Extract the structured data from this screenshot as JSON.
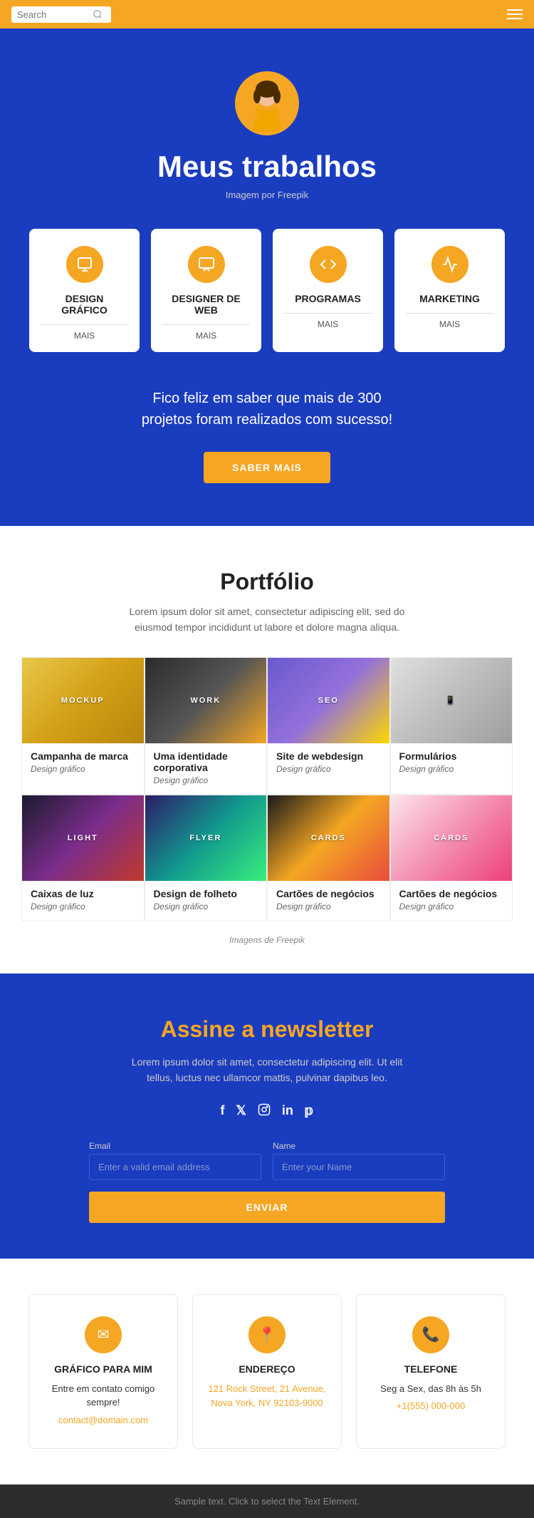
{
  "header": {
    "search_placeholder": "Search",
    "menu_icon": "hamburger-icon"
  },
  "hero": {
    "title": "Meus trabalhos",
    "image_credit": "Imagem por Freepik",
    "promo_text": "Fico feliz em saber que mais de 300 projetos foram realizados com sucesso!",
    "cta_label": "SABER MAIS"
  },
  "services": [
    {
      "title": "DESIGN\nGRÁFICO",
      "mais": "MAIS",
      "icon": "🖥"
    },
    {
      "title": "DESIGNER DE WEB",
      "mais": "MAIS",
      "icon": "🖱"
    },
    {
      "title": "PROGRAMAS",
      "mais": "MAIS",
      "icon": "💻"
    },
    {
      "title": "MARKETING",
      "mais": "MAIS",
      "icon": "📊"
    }
  ],
  "portfolio": {
    "title": "Portfólio",
    "description": "Lorem ipsum dolor sit amet, consectetur adipiscing elit, sed do eiusmod tempor incididunt ut labore et dolore magna aliqua.",
    "freepik_note": "Imagens de Freepik",
    "items": [
      {
        "title": "Campanha de marca",
        "category": "Design gráfico",
        "img_class": "img-mockup",
        "label": "MOCKUP"
      },
      {
        "title": "Uma identidade corporativa",
        "category": "Design gráfico",
        "img_class": "img-work",
        "label": "WORK"
      },
      {
        "title": "Site de webdesign",
        "category": "Design gráfico",
        "img_class": "img-seo",
        "label": "SEO"
      },
      {
        "title": "Formulários",
        "category": "Design gráfico",
        "img_class": "img-phone",
        "label": "PHONE"
      },
      {
        "title": "Caixas de luz",
        "category": "Design gráfico",
        "img_class": "img-light",
        "label": "LIGHT"
      },
      {
        "title": "Design de folheto",
        "category": "Design gráfico",
        "img_class": "img-flyer",
        "label": "FLYER"
      },
      {
        "title": "Cartões de negócios",
        "category": "Design gráfico",
        "img_class": "img-business1",
        "label": "CARDS"
      },
      {
        "title": "Cartões de negócios",
        "category": "Design gráfico",
        "img_class": "img-business2",
        "label": "CARDS"
      }
    ]
  },
  "newsletter": {
    "title": "Assine a newsletter",
    "description": "Lorem ipsum dolor sit amet, consectetur adipiscing elit. Ut elit tellus, luctus nec ullamcor mattis, pulvinar dapibus leo.",
    "social_links": [
      "f",
      "𝕏",
      "in",
      "in",
      "𝕡"
    ],
    "email_label": "Email",
    "email_placeholder": "Enter a valid email address",
    "name_label": "Name",
    "name_placeholder": "Enter your Name",
    "submit_label": "ENVIAR"
  },
  "contact": {
    "cards": [
      {
        "icon": "✉",
        "title": "GRÁFICO PARA MIM",
        "text": "Entre em contato comigo sempre!",
        "link": "contact@domain.com",
        "link_href": "mailto:contact@domain.com"
      },
      {
        "icon": "📍",
        "title": "ENDEREÇO",
        "text": "",
        "link": "121 Rock Street, 21 Avenue,\nNova York, NY 92103-9000",
        "link_href": "#"
      },
      {
        "icon": "📞",
        "title": "TELEFONE",
        "text": "Seg a Sex, das 8h às 5h",
        "link": "+1(555) 000-000",
        "link_href": "tel:+15550000000"
      }
    ]
  },
  "footer": {
    "text": "Sample text. Click to select the Text Element."
  }
}
